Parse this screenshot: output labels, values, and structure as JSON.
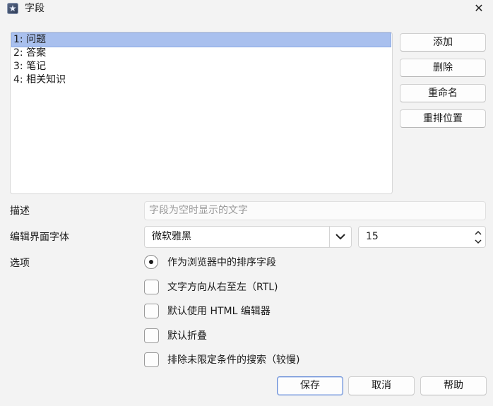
{
  "window": {
    "title": "字段",
    "close_glyph": "✕"
  },
  "fields": {
    "items": [
      {
        "label": "1: 问题",
        "selected": true
      },
      {
        "label": "2: 答案",
        "selected": false
      },
      {
        "label": "3: 笔记",
        "selected": false
      },
      {
        "label": "4: 相关知识",
        "selected": false
      }
    ]
  },
  "side_buttons": {
    "add": "添加",
    "delete": "删除",
    "rename": "重命名",
    "reposition": "重排位置"
  },
  "description": {
    "label": "描述",
    "placeholder": "字段为空时显示的文字"
  },
  "editor_font": {
    "label": "编辑界面字体",
    "font_value": "微软雅黑",
    "size_value": "15"
  },
  "options": {
    "label": "选项",
    "sort_field": {
      "label": "作为浏览器中的排序字段",
      "checked": true
    },
    "rtl": {
      "label": "文字方向从右至左（RTL)",
      "checked": false
    },
    "html_editor": {
      "label": "默认使用 HTML 编辑器",
      "checked": false
    },
    "collapse": {
      "label": "默认折叠",
      "checked": false
    },
    "exclude_search": {
      "label": "排除未限定条件的搜索（较慢)",
      "checked": false
    }
  },
  "footer": {
    "save": "保存",
    "cancel": "取消",
    "help": "帮助"
  }
}
